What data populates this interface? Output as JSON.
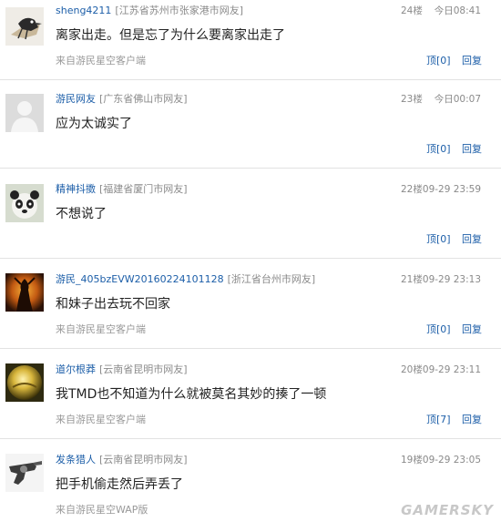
{
  "comments": [
    {
      "username": "sheng4211",
      "location": "[江苏省苏州市张家港市网友]",
      "floor": "24楼",
      "time": "今日08:41",
      "content": "离家出走。但是忘了为什么要离家出走了",
      "source": "来自游民星空客户端",
      "ding": "顶[0]",
      "reply": "回复",
      "avatar_icon": "crow-avatar-icon"
    },
    {
      "username": "游民网友",
      "location": "[广东省佛山市网友]",
      "floor": "23楼",
      "time": "今日00:07",
      "content": "应为太诚实了",
      "source": "",
      "ding": "顶[0]",
      "reply": "回复",
      "avatar_icon": "default-user-avatar-icon"
    },
    {
      "username": "精神抖擞",
      "location": "[福建省厦门市网友]",
      "floor": "22楼",
      "time": "09-29 23:59",
      "content": "不想说了",
      "source": "",
      "ding": "顶[0]",
      "reply": "回复",
      "avatar_icon": "panda-avatar-icon"
    },
    {
      "username": "游民_405bzEVW20160224101128",
      "location": "[浙江省台州市网友]",
      "floor": "21楼",
      "time": "09-29 23:13",
      "content": "和妹子出去玩不回家",
      "source": "来自游民星空客户端",
      "ding": "顶[0]",
      "reply": "回复",
      "avatar_icon": "warrior-avatar-icon"
    },
    {
      "username": "道尔根莽",
      "location": "[云南省昆明市网友]",
      "floor": "20楼",
      "time": "09-29 23:11",
      "content": "我TMD也不知道为什么就被莫名其妙的揍了一顿",
      "source": "来自游民星空客户端",
      "ding": "顶[7]",
      "reply": "回复",
      "avatar_icon": "golden-orb-avatar-icon"
    },
    {
      "username": "发条猎人",
      "location": "[云南省昆明市网友]",
      "floor": "19楼",
      "time": "09-29 23:05",
      "content": "把手机偷走然后弄丢了",
      "source": "来自游民星空WAP版",
      "ding": "",
      "reply": "",
      "avatar_icon": "revolver-avatar-icon"
    }
  ],
  "watermark": "GAMERSKY"
}
